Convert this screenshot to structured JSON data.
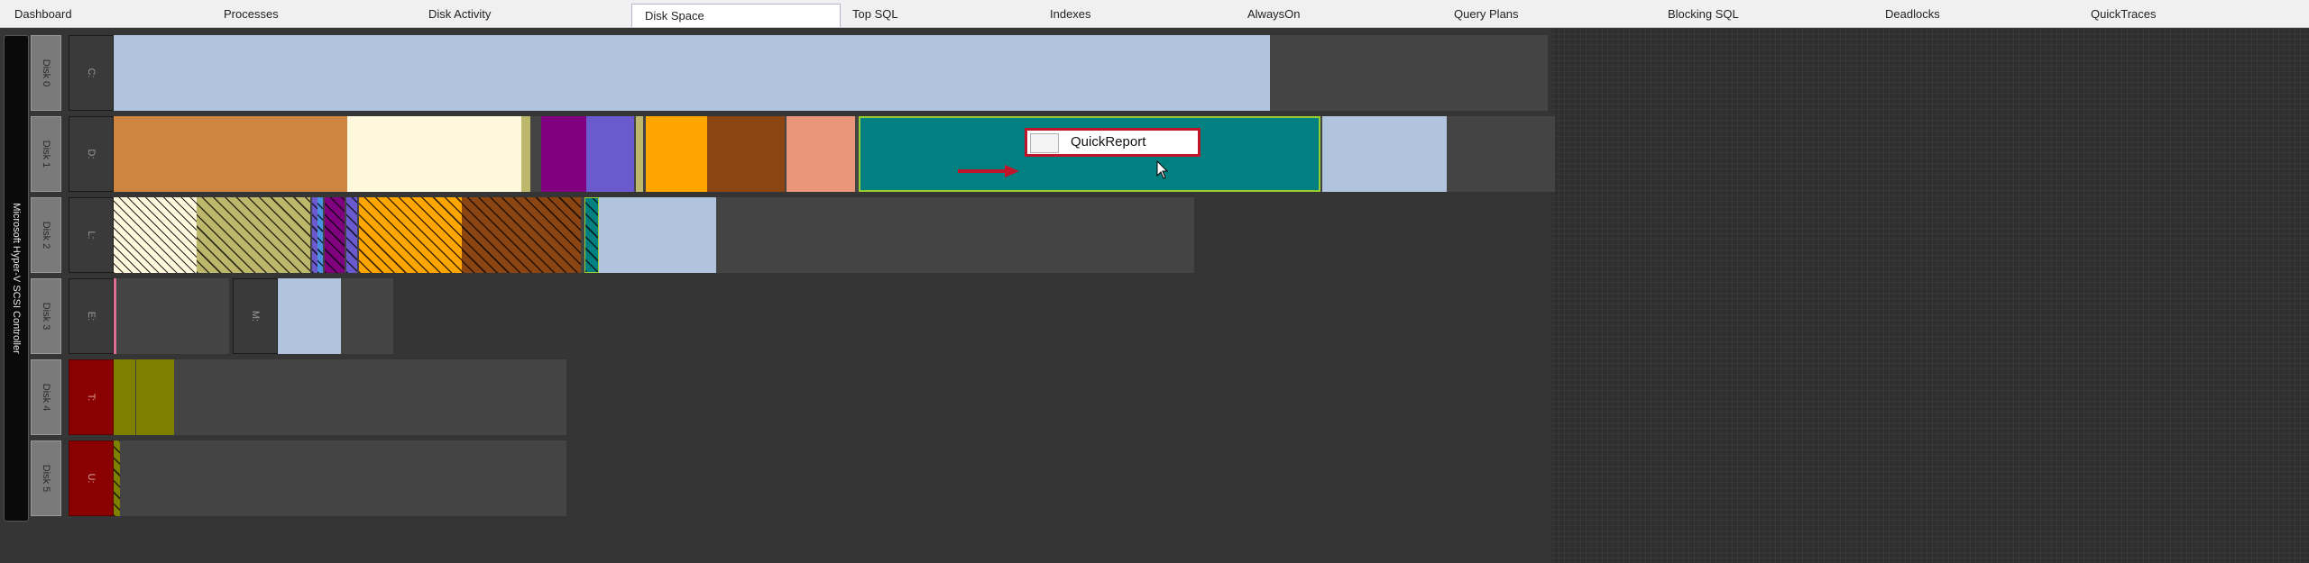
{
  "tabs": [
    {
      "label": "Dashboard",
      "active": false
    },
    {
      "label": "Processes",
      "active": false
    },
    {
      "label": "Disk Activity",
      "active": false
    },
    {
      "label": "Disk Space",
      "active": true
    },
    {
      "label": "Top SQL",
      "active": false
    },
    {
      "label": "Indexes",
      "active": false
    },
    {
      "label": "AlwaysOn",
      "active": false
    },
    {
      "label": "Query Plans",
      "active": false
    },
    {
      "label": "Blocking SQL",
      "active": false
    },
    {
      "label": "Deadlocks",
      "active": false
    },
    {
      "label": "QuickTraces",
      "active": false
    }
  ],
  "controller": {
    "label": "Microsoft Hyper-V SCSI Controller"
  },
  "disks": [
    {
      "label": "Disk 0",
      "volumes": [
        {
          "label": "C:",
          "highlight": false
        }
      ]
    },
    {
      "label": "Disk 1",
      "volumes": [
        {
          "label": "D:",
          "highlight": false
        }
      ]
    },
    {
      "label": "Disk 2",
      "volumes": [
        {
          "label": "L:",
          "highlight": false
        }
      ]
    },
    {
      "label": "Disk 3",
      "volumes": [
        {
          "label": "E:",
          "highlight": false
        },
        {
          "label": "M:",
          "highlight": false
        }
      ]
    },
    {
      "label": "Disk 4",
      "volumes": [
        {
          "label": "T:",
          "highlight": true
        }
      ]
    },
    {
      "label": "Disk 5",
      "volumes": [
        {
          "label": "U:",
          "highlight": true
        }
      ]
    }
  ],
  "popup": {
    "label": "QuickReport"
  },
  "colors": {
    "light_steel_blue": "#b0c4de",
    "peru": "#cd853f",
    "cornsilk": "#fff8dc",
    "dark_khaki": "#bdb76b",
    "purple": "#800080",
    "slate_blue": "#6a5acd",
    "orange": "#ffa500",
    "saddle_brown": "#8b4513",
    "dark_salmon": "#e9967a",
    "teal": "#008080",
    "olive": "#808000",
    "dark_red": "#8b0000",
    "popup_border": "#c0142a"
  }
}
